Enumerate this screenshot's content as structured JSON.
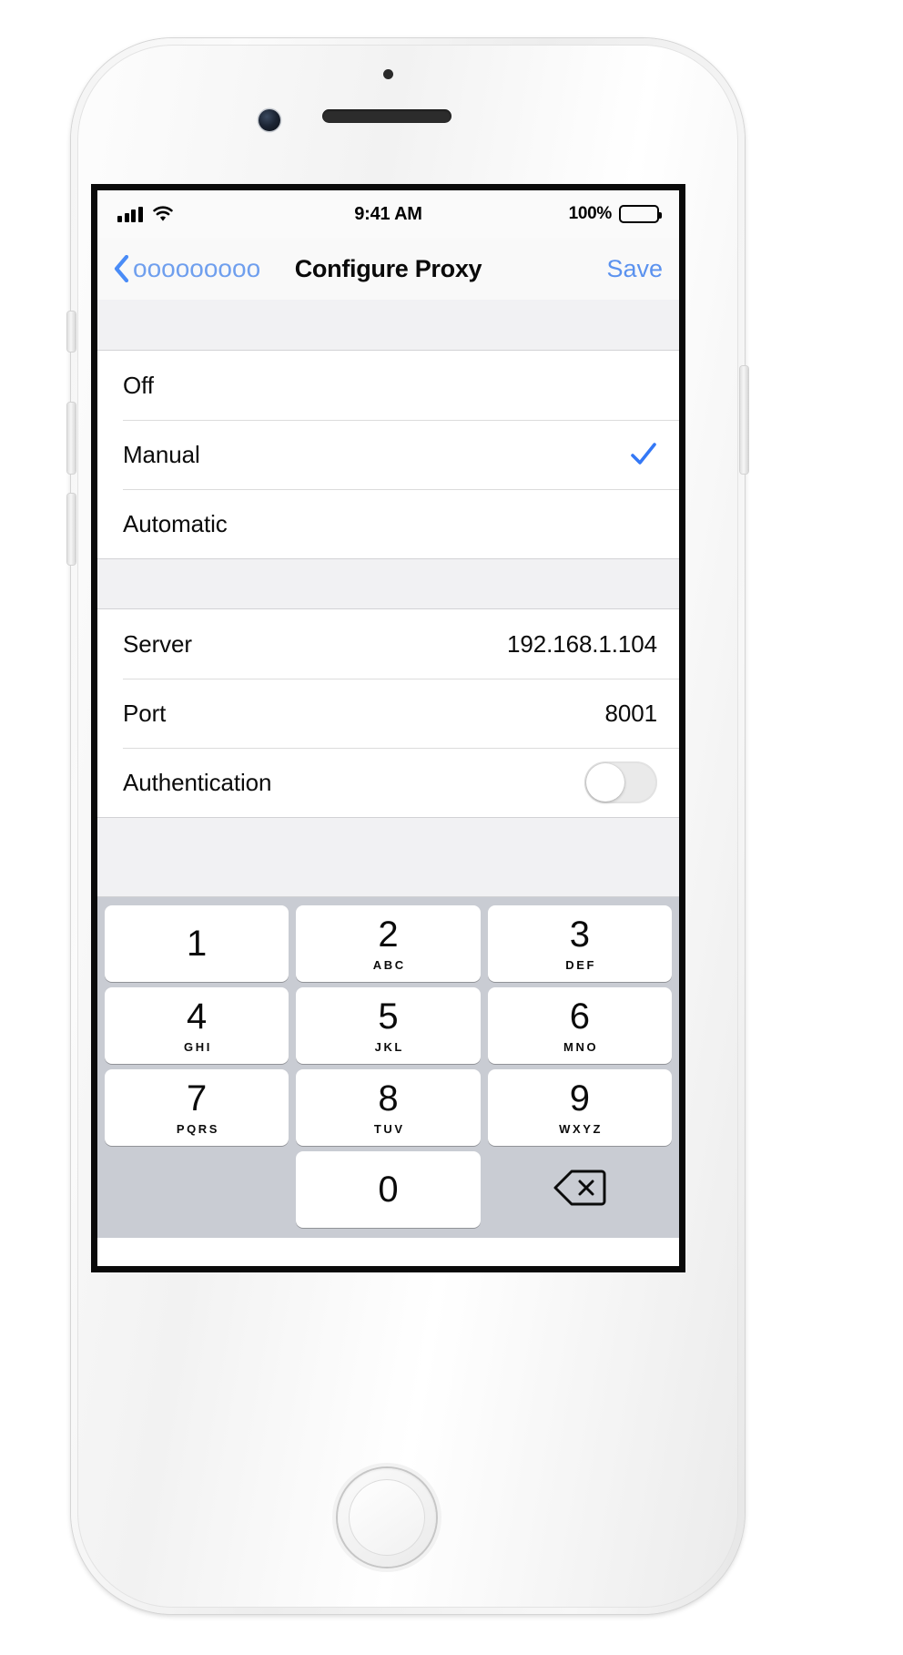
{
  "device": {
    "type": "iphone-silver",
    "home_button": "home-button"
  },
  "statusbar": {
    "signal_icon": "cellular-signal-icon",
    "wifi_icon": "wifi-icon",
    "time": "9:41 AM",
    "battery_percent": "100%",
    "battery_icon": "battery-full-icon"
  },
  "navbar": {
    "back_icon": "chevron-left-icon",
    "back_label": "ooooooooo",
    "title": "Configure Proxy",
    "save_label": "Save",
    "accent_color": "#4a8cf7"
  },
  "proxy_modes": {
    "options": [
      {
        "label": "Off",
        "selected": false
      },
      {
        "label": "Manual",
        "selected": true
      },
      {
        "label": "Automatic",
        "selected": false
      }
    ],
    "checkmark_icon": "checkmark-icon",
    "checkmark_color": "#3478f6"
  },
  "proxy_settings": {
    "rows": [
      {
        "label": "Server",
        "value": "192.168.1.104"
      },
      {
        "label": "Port",
        "value": "8001"
      }
    ],
    "toggle": {
      "label": "Authentication",
      "state": "off",
      "icon": "toggle-switch-off-icon"
    }
  },
  "keypad": {
    "keys": [
      {
        "num": "1",
        "letters": ""
      },
      {
        "num": "2",
        "letters": "ABC"
      },
      {
        "num": "3",
        "letters": "DEF"
      },
      {
        "num": "4",
        "letters": "GHI"
      },
      {
        "num": "5",
        "letters": "JKL"
      },
      {
        "num": "6",
        "letters": "MNO"
      },
      {
        "num": "7",
        "letters": "PQRS"
      },
      {
        "num": "8",
        "letters": "TUV"
      },
      {
        "num": "9",
        "letters": "WXYZ"
      },
      {
        "num": "0",
        "letters": ""
      }
    ],
    "delete_icon": "backspace-delete-icon",
    "background_color": "#c9ccd3",
    "key_color": "#ffffff"
  }
}
